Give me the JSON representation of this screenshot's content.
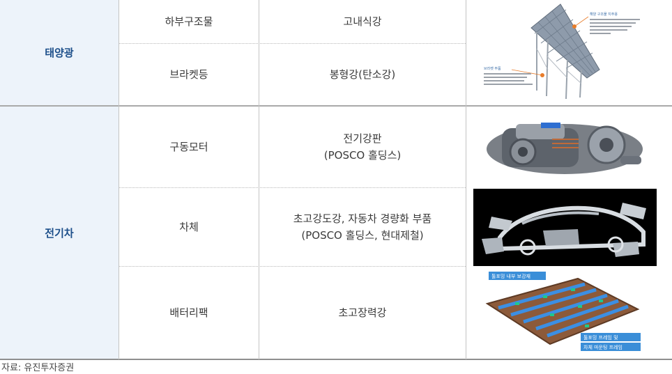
{
  "table": {
    "groups": [
      {
        "category": "태양광",
        "rows": [
          {
            "part": "하부구조물",
            "material_lines": [
              "고내식강"
            ]
          },
          {
            "part": "브라켓등",
            "material_lines": [
              "봉형강(탄소강)"
            ]
          }
        ],
        "image": {
          "name": "solar-panel-mount-image",
          "captions": [
            "해양 구조물 지주용",
            "고내식 강재",
            "브라켓 부품"
          ]
        }
      },
      {
        "category": "전기차",
        "rows": [
          {
            "part": "구동모터",
            "material_lines": [
              "전기강판",
              "(POSCO 홀딩스)"
            ]
          },
          {
            "part": "차체",
            "material_lines": [
              "초고강도강, 자동차 경량화 부품",
              "(POSCO 홀딩스, 현대제철)"
            ]
          },
          {
            "part": "배터리팩",
            "material_lines": [
              "초고장력강"
            ]
          }
        ],
        "images": [
          {
            "name": "drive-motor-image"
          },
          {
            "name": "car-body-image"
          },
          {
            "name": "battery-pack-image",
            "labels": [
              "툴포밍 내부 보강재",
              "툴포밍 프레임 및",
              "차체 마운팅 프레임"
            ]
          }
        ]
      }
    ]
  },
  "source_note": "자료: 유진투자증권",
  "colors": {
    "category_bg": "#edf3fa",
    "category_text": "#1d4f8a",
    "battery_label_bg": "#3a8ed8"
  }
}
